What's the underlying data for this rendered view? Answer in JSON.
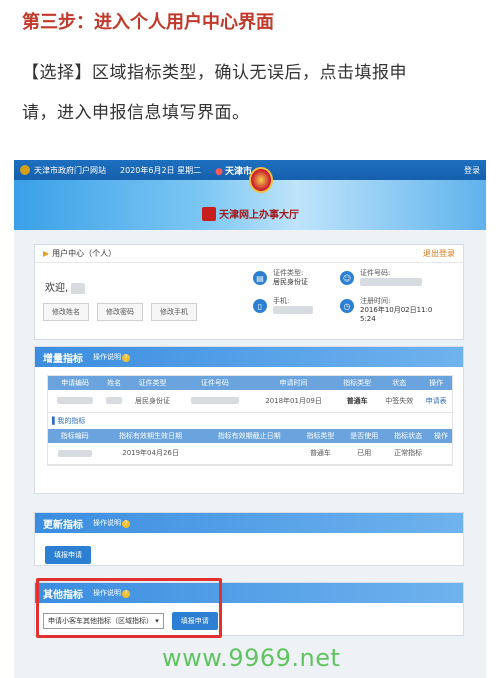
{
  "article": {
    "title": "第三步：进入个人用户中心界面",
    "line1": "【选择】区域指标类型，确认无误后，点击填报申",
    "line2": "请，进入申报信息填写界面。"
  },
  "portal": {
    "site_name": "天津市政府门户网站",
    "date": "2020年6月2日 星期二",
    "city": "天津市",
    "login": "登录",
    "hall_name": "天津网上办事大厅"
  },
  "user_center": {
    "header": "用户中心（个人）",
    "logout": "退出登录",
    "welcome": "欢迎,",
    "buttons": [
      "修改姓名",
      "修改密码",
      "修改手机"
    ],
    "id_type_label": "证件类型:",
    "id_type_value": "居民身份证",
    "id_number_label": "证件号码:",
    "phone_label": "手机:",
    "reg_time_label": "注册时间:",
    "reg_time_value_1": "2016年10月02日11:0",
    "reg_time_value_2": "5:24"
  },
  "increment": {
    "title": "增量指标",
    "help": "操作说明",
    "headers": [
      "申请编码",
      "姓名",
      "证件类型",
      "证件号码",
      "申请时间",
      "指标类型",
      "状态",
      "操作"
    ],
    "row": {
      "id_type": "居民身份证",
      "date": "2018年01月09日",
      "car_type": "普通车",
      "status": "中签失效",
      "action": "申请表"
    },
    "my_index_label": "我的指标",
    "headers2": [
      "指标编码",
      "指标有效期生效日期",
      "指标有效期截止日期",
      "指标类型",
      "是否使用",
      "指标状态",
      "操作"
    ],
    "row2": {
      "start": "2019年04月26日",
      "car_type": "普通车",
      "used": "已用",
      "state": "正常指标"
    }
  },
  "update": {
    "title": "更新指标",
    "help": "操作说明",
    "button": "填报申请"
  },
  "other": {
    "title": "其他指标",
    "help": "操作说明",
    "select_value": "申请小客车其他指标（区域指标）",
    "button": "填报申请"
  },
  "watermark": "www.9969.net"
}
